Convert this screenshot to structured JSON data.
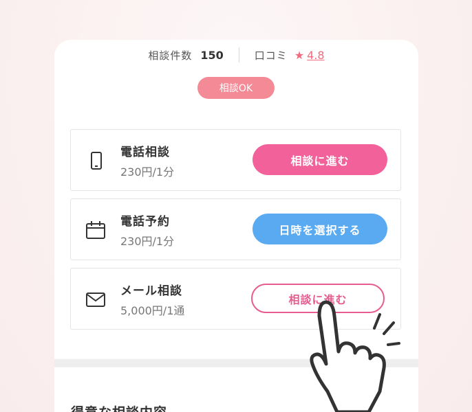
{
  "stats": {
    "count_label": "相談件数",
    "count_value": "150",
    "review_label": "口コミ",
    "rating": "4.8"
  },
  "badge": "相談OK",
  "options": [
    {
      "title": "電話相談",
      "price": "230円/1分",
      "button": "相談に進む",
      "icon": "phone-icon"
    },
    {
      "title": "電話予約",
      "price": "230円/1分",
      "button": "日時を選択する",
      "icon": "calendar-icon"
    },
    {
      "title": "メール相談",
      "price": "5,000円/1通",
      "button": "相談に進む",
      "icon": "mail-icon"
    }
  ],
  "section_title": "得意な相談内容",
  "colors": {
    "pink_button": "#f2619a",
    "blue_button": "#5aaaf1",
    "badge": "#f48a96",
    "rating": "#ef6b7d"
  }
}
